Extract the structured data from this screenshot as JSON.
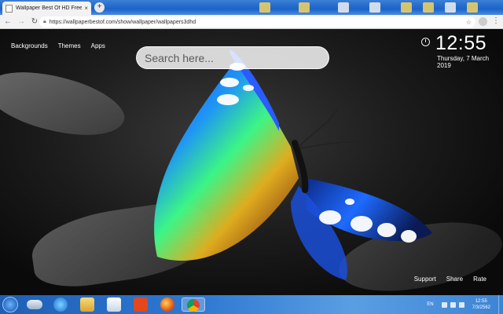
{
  "browser": {
    "tab_title": "Wallpaper Best Of HD Free - wall",
    "tab_close": "×",
    "new_tab": "+",
    "url": "https://wallpaperbestof.com/show/wallpaper/wallpapers3dhd"
  },
  "page": {
    "nav": [
      "Backgrounds",
      "Themes",
      "Apps"
    ],
    "search_placeholder": "Search here...",
    "time": "12:55",
    "date": "Thursday, 7 March 2019",
    "footer": [
      "Support",
      "Share",
      "Rate"
    ]
  },
  "taskbar": {
    "language": "EN",
    "clock_time": "12:55",
    "clock_date": "7/3/2562",
    "icons": [
      "start-orb-icon",
      "cloud-icon",
      "internet-explorer-icon",
      "file-explorer-icon",
      "media-player-icon",
      "office-icon",
      "firefox-icon",
      "chrome-icon"
    ]
  },
  "colors": {
    "taskbar": "#2e79d2",
    "tabstrip": "#1a63c8",
    "butterfly_blue": "#1e7bff",
    "butterfly_green": "#3cff8a",
    "butterfly_orange": "#e08a1e"
  }
}
